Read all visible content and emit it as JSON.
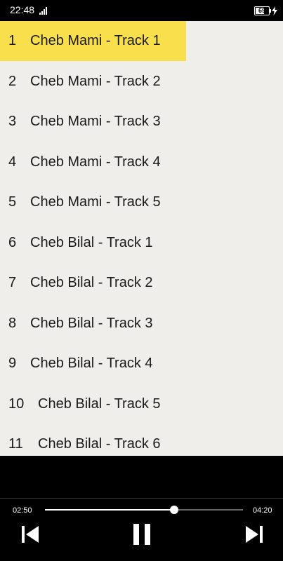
{
  "status_bar": {
    "time": "22:48",
    "battery_percent": "69",
    "battery_level": 0.69,
    "icons": [
      "signal-icon",
      "battery-icon",
      "charging-bolt-icon"
    ]
  },
  "tracks": [
    {
      "number": "1",
      "title": "Cheb Mami - Track 1",
      "active": true
    },
    {
      "number": "2",
      "title": "Cheb Mami - Track 2"
    },
    {
      "number": "3",
      "title": "Cheb Mami - Track 3"
    },
    {
      "number": "4",
      "title": "Cheb Mami - Track 4"
    },
    {
      "number": "5",
      "title": "Cheb Mami - Track 5"
    },
    {
      "number": "6",
      "title": "Cheb Bilal - Track 1"
    },
    {
      "number": "7",
      "title": "Cheb Bilal - Track 2"
    },
    {
      "number": "8",
      "title": "Cheb Bilal - Track 3"
    },
    {
      "number": "9",
      "title": "Cheb Bilal - Track 4"
    },
    {
      "number": "10",
      "title": "Cheb Bilal - Track 5"
    },
    {
      "number": "11",
      "title": "Cheb Bilal - Track 6"
    }
  ],
  "player": {
    "elapsed": "02:50",
    "total": "04:20",
    "progress": 0.654,
    "controls": [
      "skip-previous-icon",
      "pause-icon",
      "skip-next-icon"
    ]
  },
  "colors": {
    "active_track_bg": "#f8df4b",
    "list_bg": "#efeeeb",
    "player_bg": "#000000"
  }
}
